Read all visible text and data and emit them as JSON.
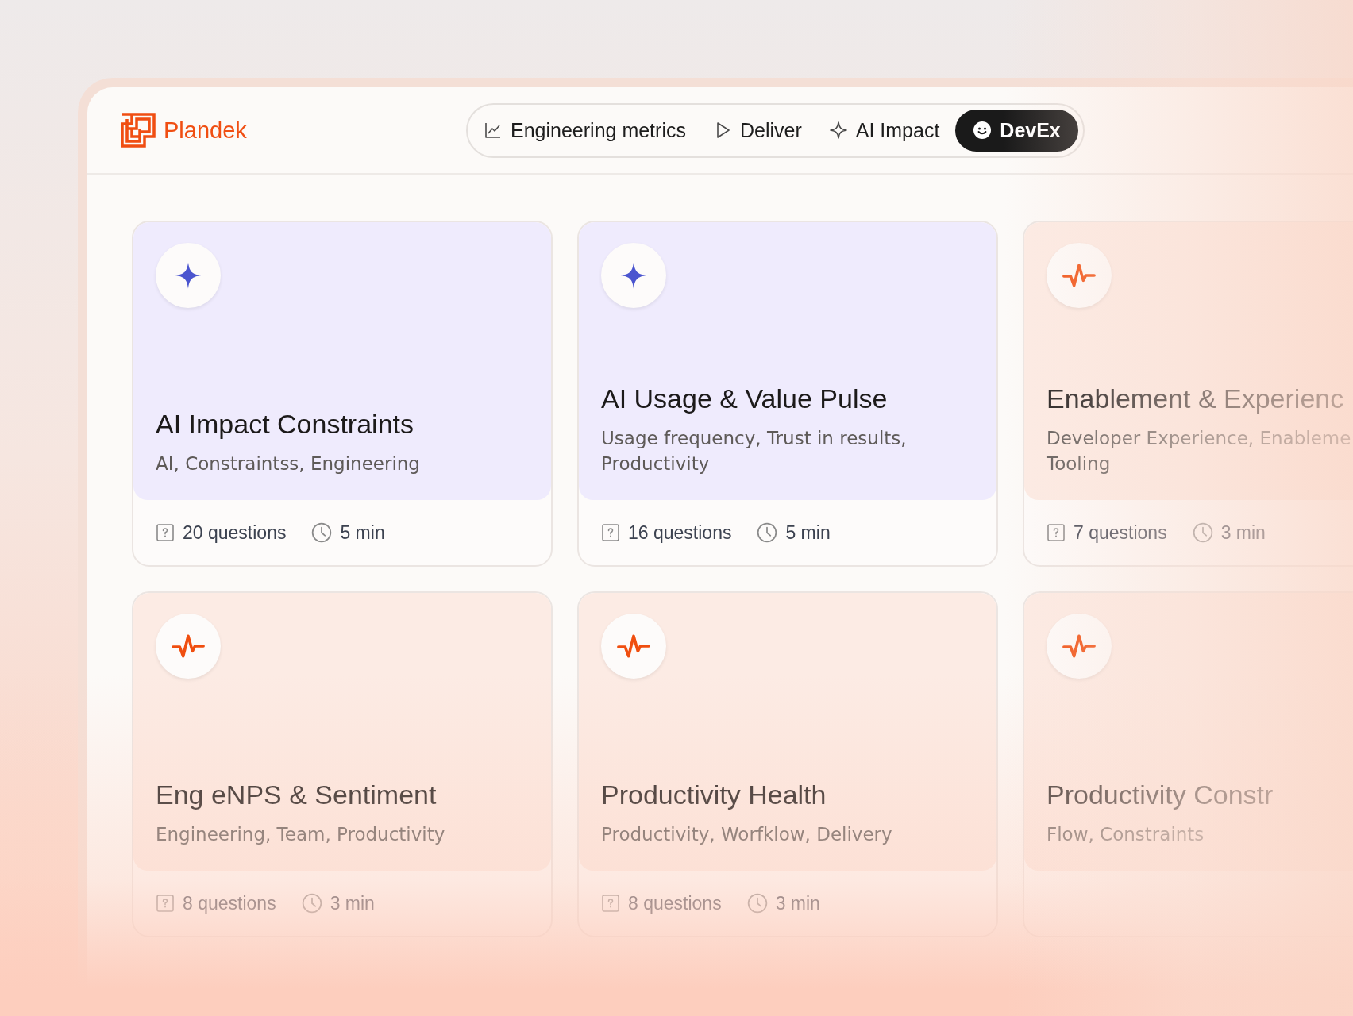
{
  "brand": {
    "name": "Plandek"
  },
  "nav": [
    {
      "label": "Engineering metrics",
      "kind": "chart",
      "selected": false
    },
    {
      "label": "Deliver",
      "kind": "play",
      "selected": false
    },
    {
      "label": "AI Impact",
      "kind": "sparkle",
      "selected": false
    },
    {
      "label": "DevEx",
      "kind": "smile",
      "selected": true
    }
  ],
  "cards": [
    {
      "kind": "ai",
      "title": "AI Impact Constraints",
      "tag_lines": [
        "AI, Constraintss, Engineering"
      ],
      "questions": "20 questions",
      "duration": "5 min"
    },
    {
      "kind": "ai",
      "title": "AI Usage & Value Pulse",
      "tag_lines": [
        "Usage frequency, Trust in results,",
        "Productivity"
      ],
      "questions": "16 questions",
      "duration": "5 min"
    },
    {
      "kind": "devex",
      "title": "Enablement & Experienc",
      "tag_lines": [
        "Developer Experience, Enableme",
        "Tooling"
      ],
      "questions": "7 questions",
      "duration": "3 min"
    },
    {
      "kind": "devex",
      "title": "Eng eNPS & Sentiment",
      "tag_lines": [
        "Engineering, Team, Productivity"
      ],
      "questions": "8 questions",
      "duration": "3 min"
    },
    {
      "kind": "devex",
      "title": "Productivity Health",
      "tag_lines": [
        "Productivity, Worfklow, Delivery"
      ],
      "questions": "8 questions",
      "duration": "3 min"
    },
    {
      "kind": "devex",
      "title": "Productivity Constr",
      "tag_lines": [
        "Flow, Constraints"
      ]
    }
  ]
}
